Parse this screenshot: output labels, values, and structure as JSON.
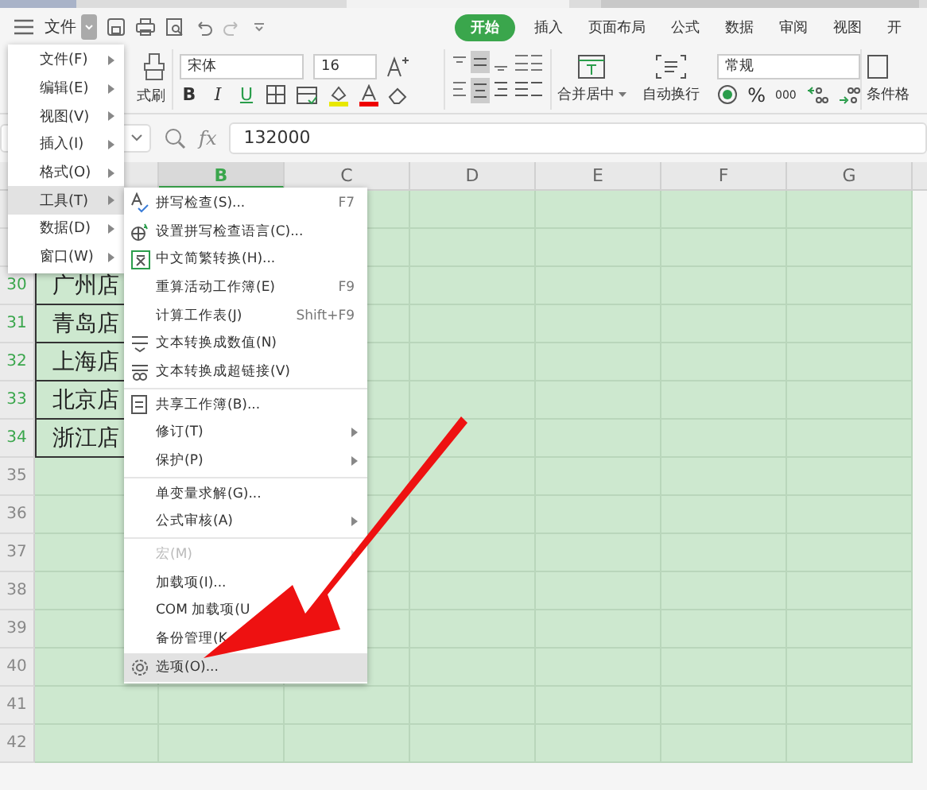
{
  "menu_bar": {
    "file_button": "文件",
    "tabs": [
      {
        "label": "开始",
        "selected": true
      },
      {
        "label": "插入",
        "selected": false
      },
      {
        "label": "页面布局",
        "selected": false
      },
      {
        "label": "公式",
        "selected": false
      },
      {
        "label": "数据",
        "selected": false
      },
      {
        "label": "审阅",
        "selected": false
      },
      {
        "label": "视图",
        "selected": false
      },
      {
        "label": "开",
        "selected": false
      }
    ]
  },
  "ribbon": {
    "format_painter": "式刷",
    "font_name": "宋体",
    "font_size": "16",
    "bold": "B",
    "italic": "I",
    "underline": "U",
    "merge": "合并居中",
    "wrap": "自动换行",
    "number_format": "常规",
    "percent": "%",
    "thousands": "000",
    "conditional": "条件格"
  },
  "formula_bar": {
    "fx": "fx",
    "value": "132000"
  },
  "columns": [
    {
      "label": "B",
      "selected": true
    },
    {
      "label": "C",
      "selected": false
    },
    {
      "label": "D",
      "selected": false
    },
    {
      "label": "E",
      "selected": false
    },
    {
      "label": "F",
      "selected": false
    },
    {
      "label": "G",
      "selected": false
    }
  ],
  "rows": [
    {
      "number": "",
      "cell": ""
    },
    {
      "number": "",
      "cell": ""
    },
    {
      "number": "30",
      "cell": "广州店",
      "selected": true
    },
    {
      "number": "31",
      "cell": "青岛店",
      "selected": true
    },
    {
      "number": "32",
      "cell": "上海店",
      "selected": true
    },
    {
      "number": "33",
      "cell": "北京店",
      "selected": true
    },
    {
      "number": "34",
      "cell": "浙江店",
      "selected": true
    },
    {
      "number": "35",
      "cell": "",
      "selected": false
    },
    {
      "number": "36",
      "cell": "",
      "selected": false
    },
    {
      "number": "37",
      "cell": "",
      "selected": false
    },
    {
      "number": "38",
      "cell": "",
      "selected": false
    },
    {
      "number": "39",
      "cell": "",
      "selected": false
    },
    {
      "number": "40",
      "cell": "",
      "selected": false
    },
    {
      "number": "41",
      "cell": "",
      "selected": false
    },
    {
      "number": "42",
      "cell": "",
      "selected": false
    }
  ],
  "file_menu": [
    {
      "label": "文件(F)",
      "selected": false
    },
    {
      "label": "编辑(E)",
      "selected": false
    },
    {
      "label": "视图(V)",
      "selected": false
    },
    {
      "label": "插入(I)",
      "selected": false
    },
    {
      "label": "格式(O)",
      "selected": false
    },
    {
      "label": "工具(T)",
      "selected": true
    },
    {
      "label": "数据(D)",
      "selected": false
    },
    {
      "label": "窗口(W)",
      "selected": false
    }
  ],
  "tools_menu": [
    {
      "kind": "item",
      "label": "拼写检查(S)...",
      "shortcut": "F7"
    },
    {
      "kind": "item",
      "label": "设置拼写检查语言(C)..."
    },
    {
      "kind": "item",
      "label": "中文简繁转换(H)..."
    },
    {
      "kind": "item",
      "label": "重算活动工作簿(E)",
      "shortcut": "F9"
    },
    {
      "kind": "item",
      "label": "计算工作表(J)",
      "shortcut": "Shift+F9"
    },
    {
      "kind": "item",
      "label": "文本转换成数值(N)"
    },
    {
      "kind": "item",
      "label": "文本转换成超链接(V)"
    },
    {
      "kind": "separator"
    },
    {
      "kind": "item",
      "label": "共享工作簿(B)..."
    },
    {
      "kind": "submenu",
      "label": "修订(T)"
    },
    {
      "kind": "submenu",
      "label": "保护(P)"
    },
    {
      "kind": "separator"
    },
    {
      "kind": "item",
      "label": "单变量求解(G)..."
    },
    {
      "kind": "submenu",
      "label": "公式审核(A)"
    },
    {
      "kind": "separator"
    },
    {
      "kind": "submenu",
      "label": "宏(M)",
      "disabled": true
    },
    {
      "kind": "item",
      "label": "加载项(I)..."
    },
    {
      "kind": "item",
      "label": "COM 加载项(U"
    },
    {
      "kind": "item",
      "label": "备份管理(K"
    },
    {
      "kind": "item",
      "label": "选项(O)...",
      "selected": true
    }
  ]
}
